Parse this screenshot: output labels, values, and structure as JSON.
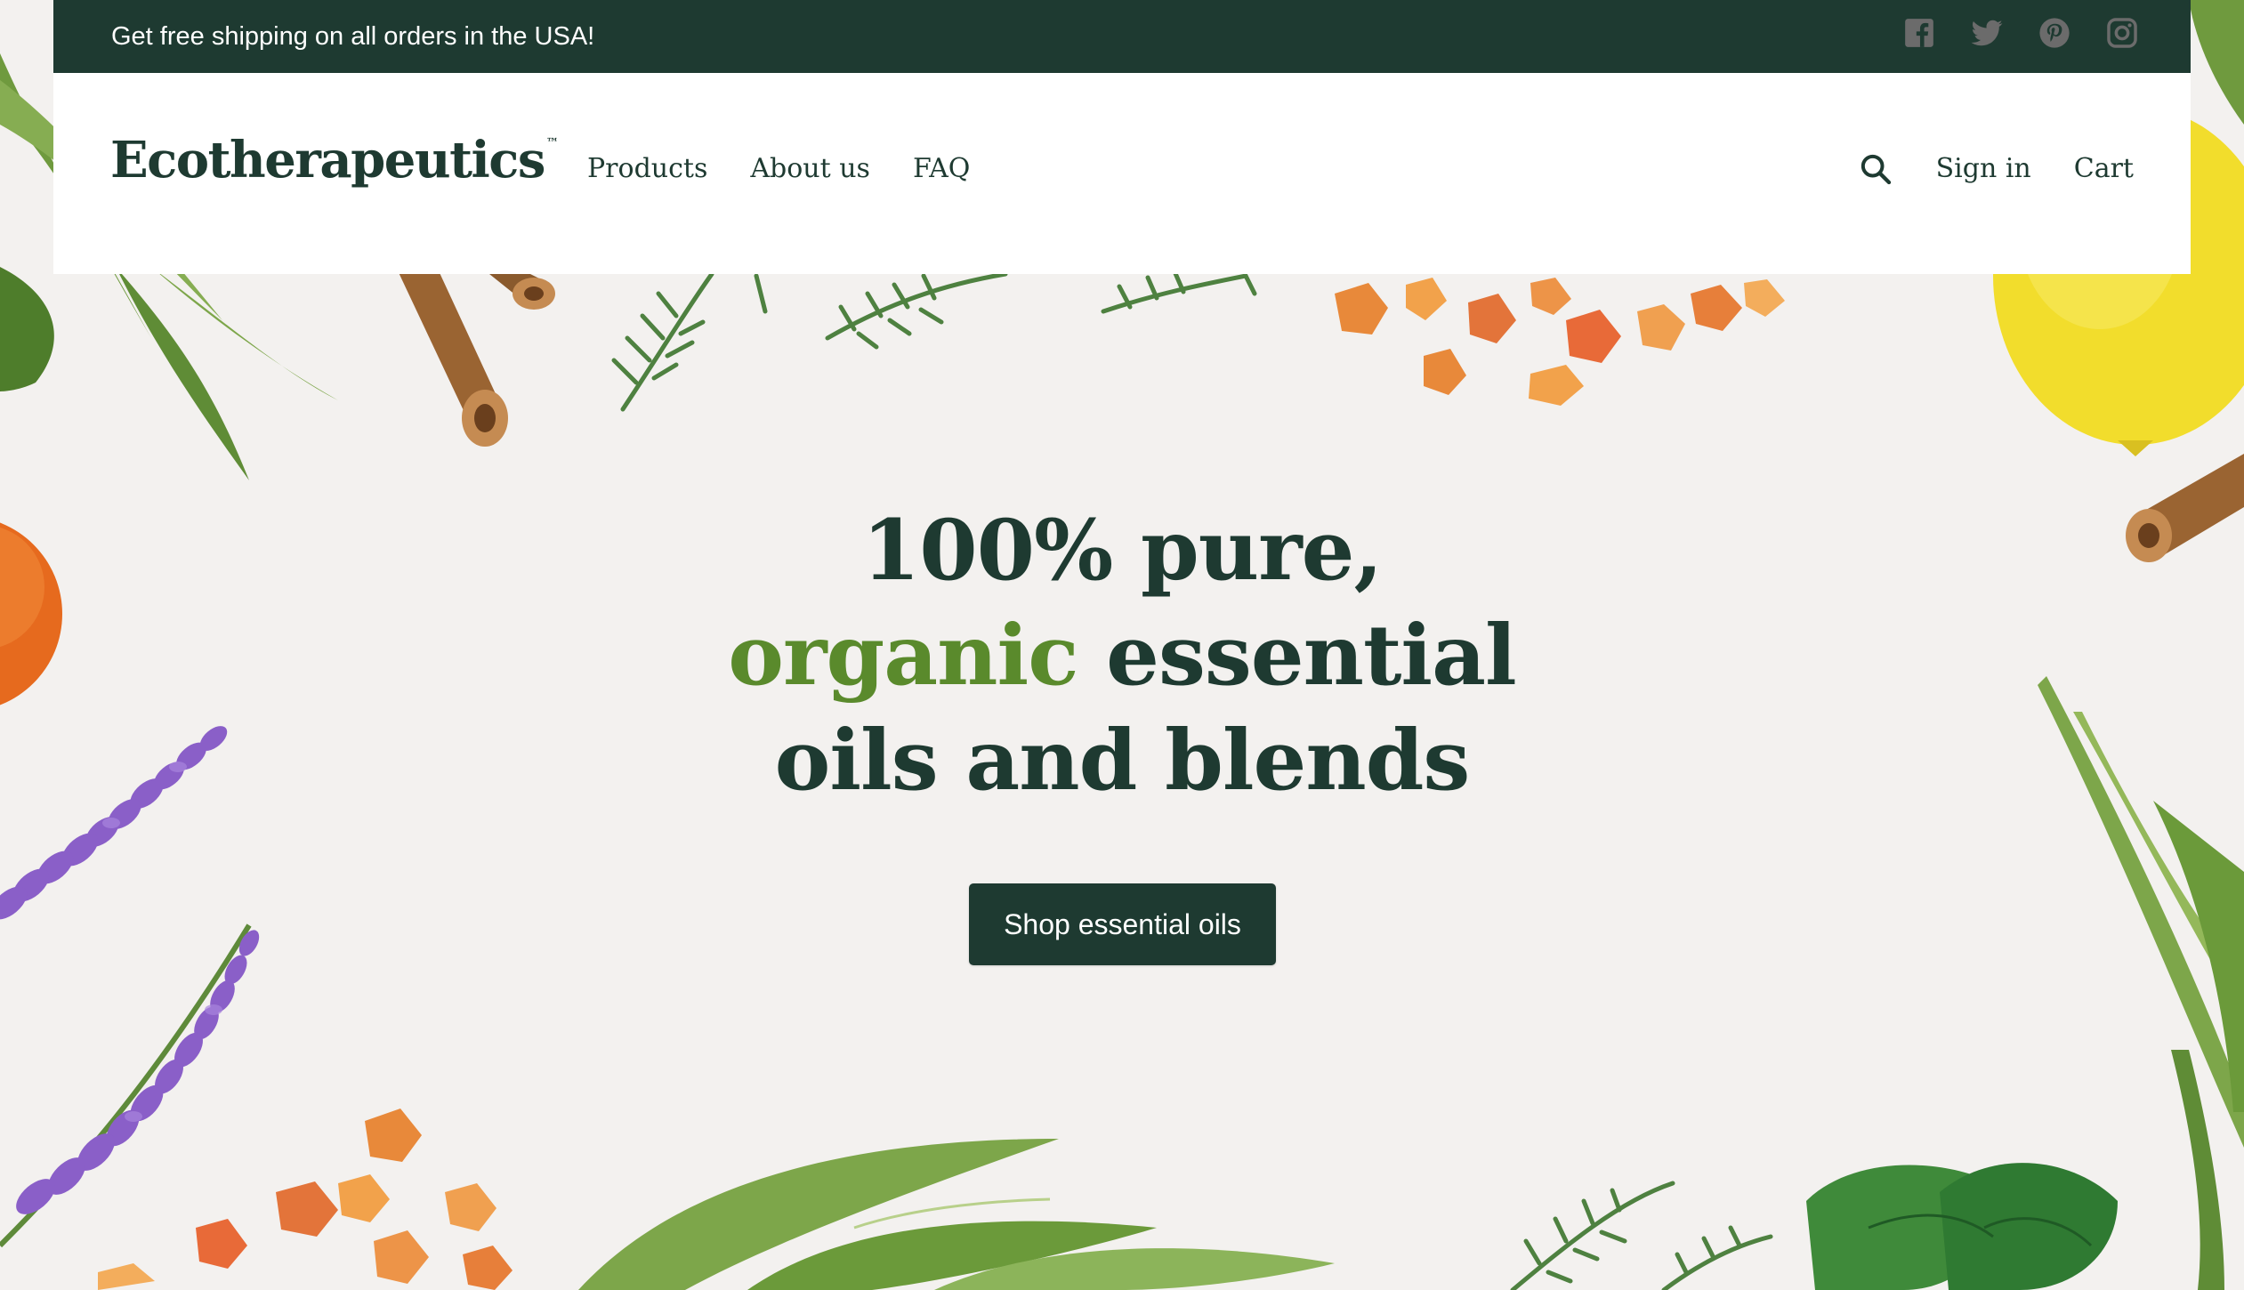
{
  "announcement": {
    "text": "Get free shipping on all orders in the USA!"
  },
  "social": [
    {
      "name": "facebook-icon"
    },
    {
      "name": "twitter-icon"
    },
    {
      "name": "pinterest-icon"
    },
    {
      "name": "instagram-icon"
    }
  ],
  "header": {
    "logo": "Ecotherapeutics",
    "logo_mark": "™",
    "nav": [
      "Products",
      "About us",
      "FAQ"
    ],
    "search_icon": "search-icon",
    "sign_in": "Sign in",
    "cart": "Cart"
  },
  "hero": {
    "line1": "100% pure,",
    "line2_highlight": "organic",
    "line2_rest": " essential",
    "line3": "oils and blends",
    "cta": "Shop essential oils"
  },
  "colors": {
    "primary": "#1e3a31",
    "accent_green": "#5a8a2c",
    "background": "#f3f1ef",
    "social_icon": "#6b6b6b"
  }
}
